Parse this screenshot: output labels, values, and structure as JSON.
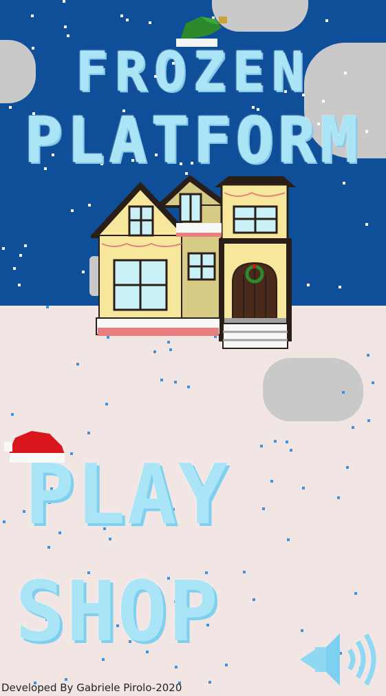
{
  "game": {
    "title_line1": "FROZEN",
    "title_line2": "PLATFORM",
    "credit": "Developed By Gabriele Pirolo-2020"
  },
  "menu": {
    "play_label": "PLAY",
    "shop_label": "SHOP"
  },
  "icons": {
    "sound": "speaker-icon",
    "title_hat": "elf-hat-icon",
    "play_hat": "santa-hat-icon",
    "house": "house-illustration"
  },
  "colors": {
    "sky": "#0f4f9a",
    "ground": "#f1e6e4",
    "title": "#a9e4f7",
    "menu_text": "#a9e4f7",
    "cloud": "#c9c9c9",
    "house_wall": "#f6e79d",
    "house_roof": "#2a1e18",
    "door": "#4a2a1a",
    "santa_hat": "#d9161c",
    "elf_hat": "#2c8a2c",
    "credit_text": "#222222"
  }
}
